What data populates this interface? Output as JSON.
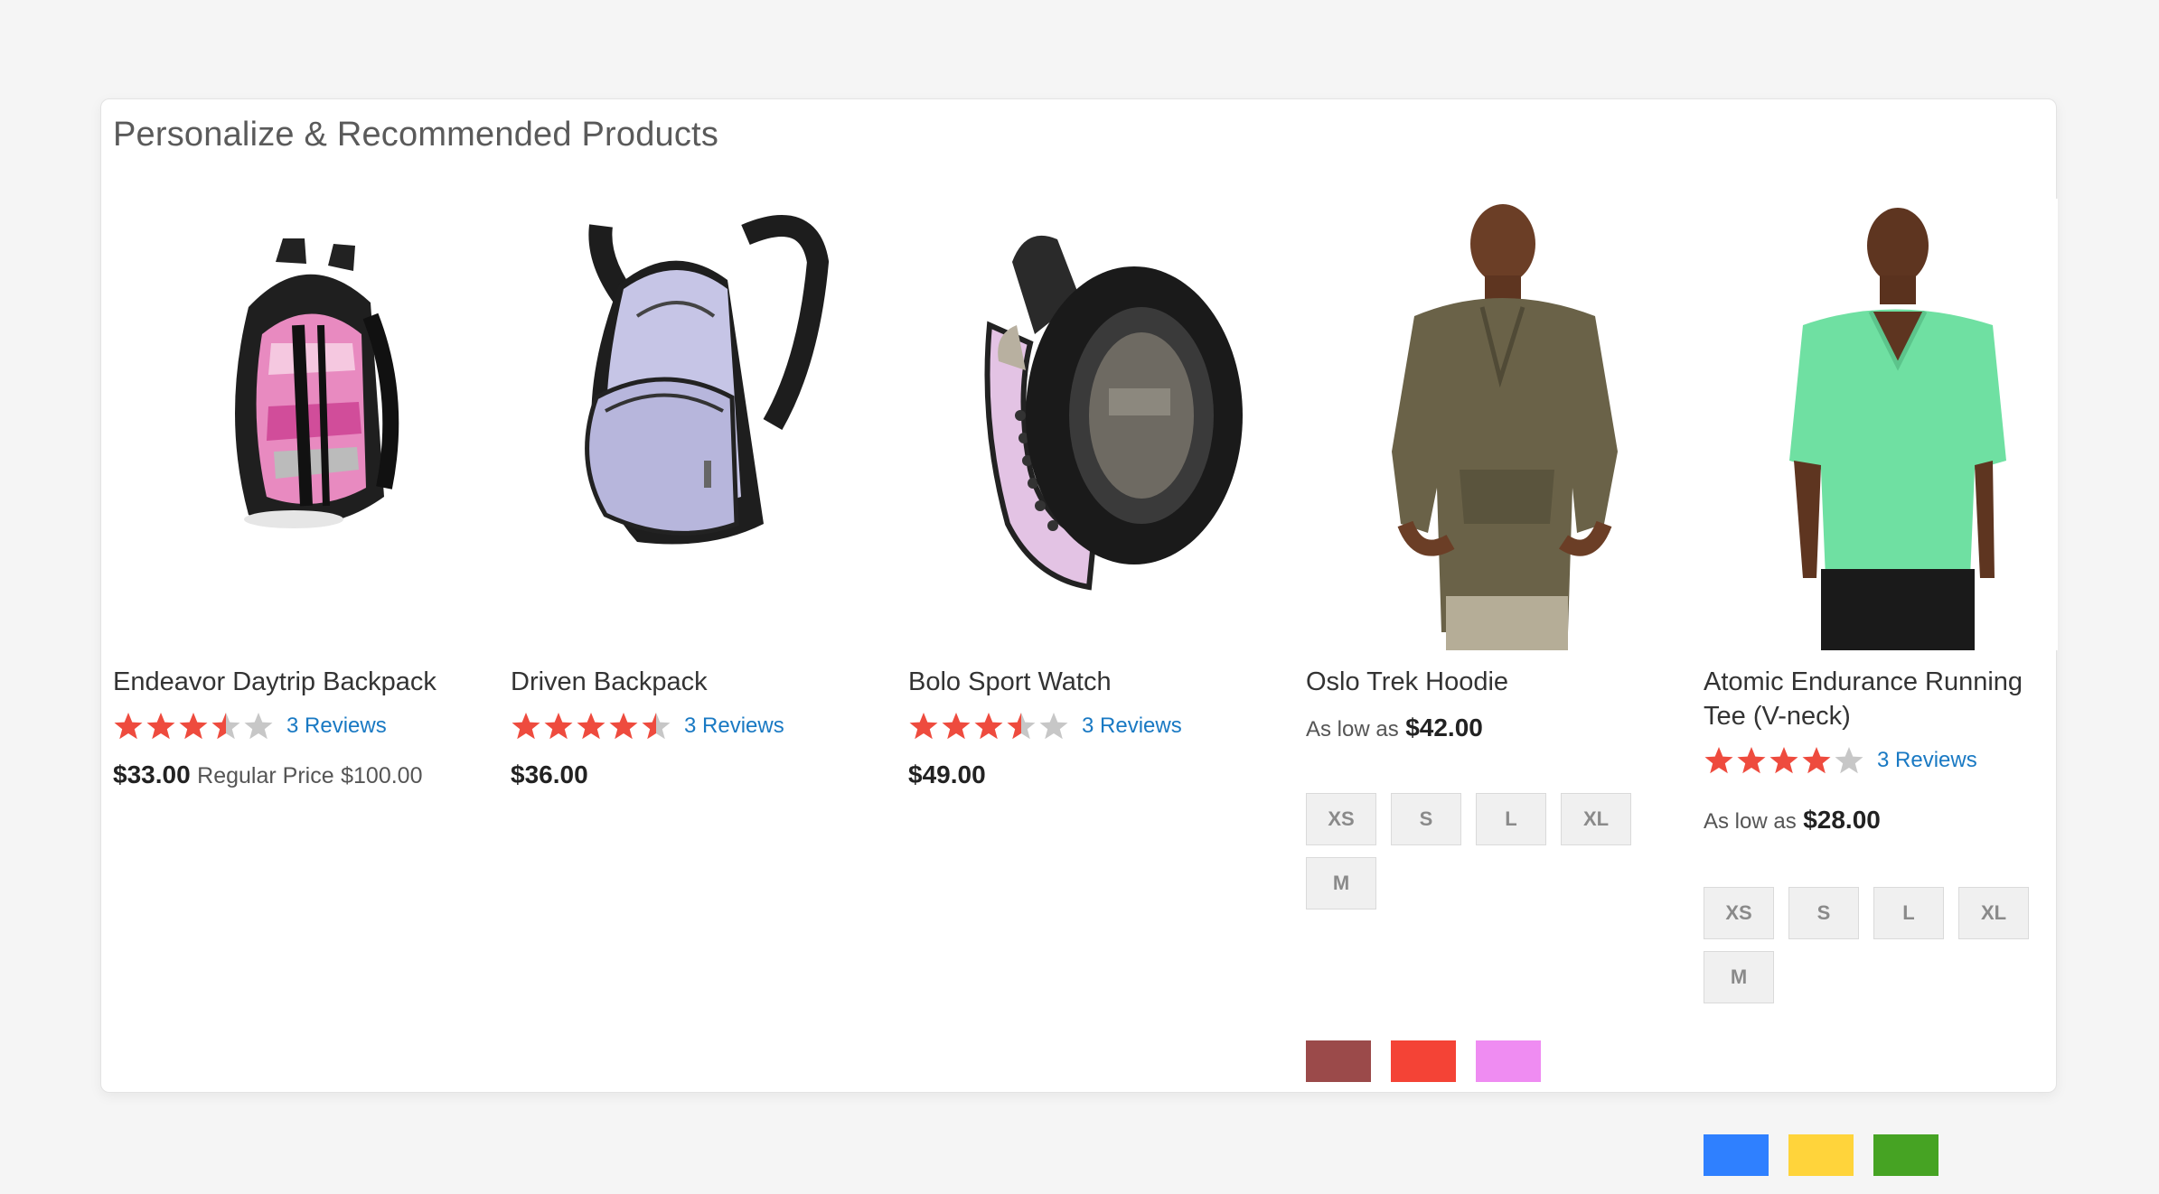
{
  "widget": {
    "title": "Personalize & Recommended Products"
  },
  "colors": {
    "star_filled": "#ee4b3e",
    "star_empty": "#c7c7c7",
    "link": "#1979c3"
  },
  "products": [
    {
      "name": "Endeavor Daytrip Backpack",
      "image_icon": "pink-black-backpack",
      "rating_stars": 3.5,
      "reviews_label": "3 Reviews",
      "price": "$33.00",
      "regular_price_label": "Regular Price",
      "regular_price": "$100.00"
    },
    {
      "name": "Driven Backpack",
      "image_icon": "lavender-black-backpack",
      "rating_stars": 4.5,
      "reviews_label": "3 Reviews",
      "price": "$36.00"
    },
    {
      "name": "Bolo Sport Watch",
      "image_icon": "pink-black-sport-watch",
      "rating_stars": 3.5,
      "reviews_label": "3 Reviews",
      "price": "$49.00"
    },
    {
      "name": "Oslo Trek Hoodie",
      "image_icon": "man-in-olive-hoodie",
      "as_low_as_label": "As low as",
      "price": "$42.00",
      "sizes": [
        "XS",
        "S",
        "L",
        "XL",
        "M"
      ],
      "colors": [
        "#9b4a4a",
        "#f44336",
        "#ef8cf2"
      ]
    },
    {
      "name": "Atomic Endurance Running Tee (V-neck)",
      "image_icon": "man-in-mint-tee",
      "rating_stars": 4,
      "reviews_label": "3 Reviews",
      "as_low_as_label": "As low as",
      "price": "$28.00",
      "sizes": [
        "XS",
        "S",
        "L",
        "XL",
        "M"
      ],
      "colors": [
        "#2f80ff",
        "#ffd43b",
        "#46a323"
      ]
    }
  ]
}
